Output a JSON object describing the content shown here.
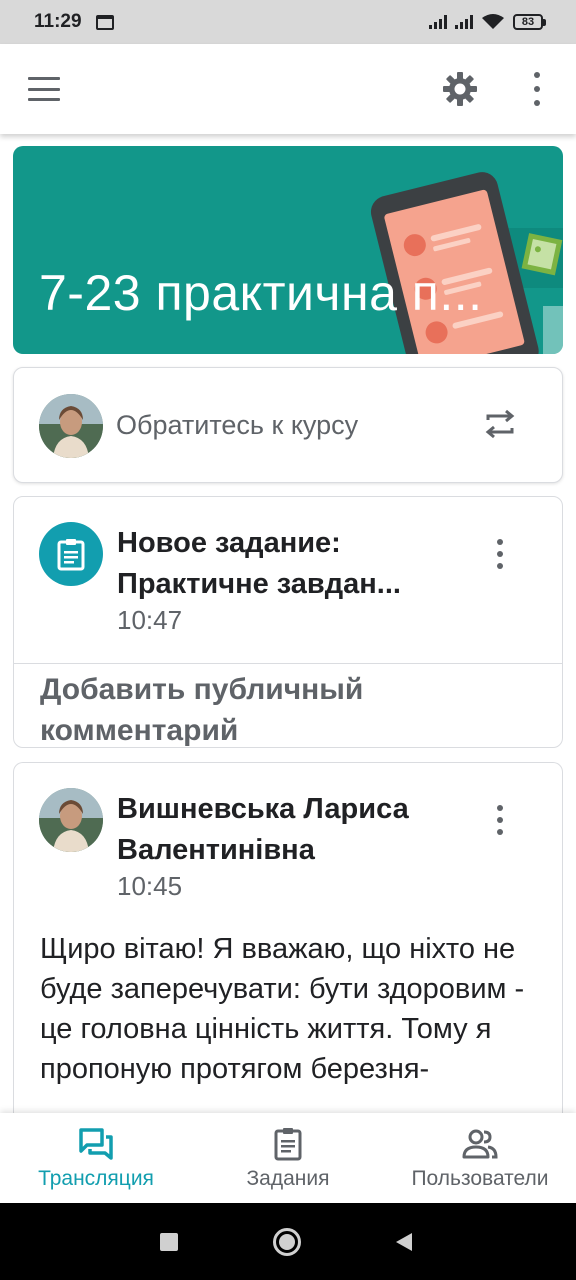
{
  "status_bar": {
    "time": "11:29",
    "battery": "83"
  },
  "banner": {
    "title": "7-23 практична п...",
    "color": "#12978a"
  },
  "share": {
    "text": "Обратитесь к курсу"
  },
  "assignment": {
    "title_line1": "Новое задание:",
    "title_line2": "Практичне завдан...",
    "time": "10:47",
    "comment_placeholder": "Добавить публичный комментарий"
  },
  "post": {
    "author_line1": "Вишневська Лариса",
    "author_line2": "Валентинівна",
    "time": "10:45",
    "text": "Щиро вітаю! Я вважаю, що ніхто не буде заперечувати: бути здоровим - це головна цінність життя. Тому я пропоную протягом березня-"
  },
  "bottom_nav": {
    "items": [
      {
        "label": "Трансляция",
        "icon": "stream-icon",
        "active": true
      },
      {
        "label": "Задания",
        "icon": "assignment-icon",
        "active": false
      },
      {
        "label": "Пользователи",
        "icon": "people-icon",
        "active": false
      }
    ]
  },
  "colors": {
    "accent": "#129eaf",
    "banner": "#12978a",
    "text_secondary": "#5f6368"
  }
}
